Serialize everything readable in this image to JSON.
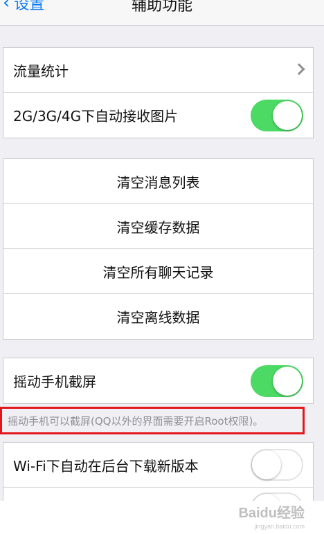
{
  "navbar": {
    "back_label": "设置",
    "title": "辅助功能"
  },
  "group1": {
    "traffic_stats": "流量统计",
    "auto_receive_images": "2G/3G/4G下自动接收图片",
    "auto_receive_images_on": true
  },
  "group2": {
    "clear_message_list": "清空消息列表",
    "clear_cache": "清空缓存数据",
    "clear_chat_history": "清空所有聊天记录",
    "clear_offline_data": "清空离线数据"
  },
  "group3": {
    "shake_screenshot": "摇动手机截屏",
    "shake_screenshot_on": true,
    "footnote": "摇动手机可以截屏(QQ以外的界面需要开启Root权限)。"
  },
  "group4": {
    "wifi_auto_download": "Wi-Fi下自动在后台下载新版本",
    "wifi_auto_download_on": false
  },
  "watermark": {
    "brand": "Baidu经验",
    "url": "jingyan.baidu.com"
  },
  "colors": {
    "accent": "#0a7cf6",
    "toggle_on": "#4cd964",
    "highlight_box": "#e3161c"
  }
}
